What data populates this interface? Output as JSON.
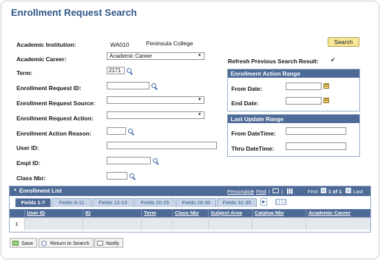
{
  "page": {
    "title": "Enrollment Request Search"
  },
  "search_button": "Search",
  "form": {
    "academic_institution_label": "Academic Institution:",
    "academic_institution_value": "WA010",
    "academic_institution_desc": "Peninsula College",
    "academic_career_label": "Academic Career:",
    "academic_career_value": "Academic Career",
    "term_label": "Term:",
    "term_value": "2171",
    "enrollment_request_id_label": "Enrollment Request ID:",
    "enrollment_request_id_value": "",
    "enrollment_request_source_label": "Enrollment Request Source:",
    "enrollment_request_source_value": "",
    "enrollment_request_action_label": "Enrollment Request Action:",
    "enrollment_request_action_value": "",
    "enrollment_action_reason_label": "Enrollment Action Reason:",
    "enrollment_action_reason_value": "",
    "user_id_label": "User ID:",
    "user_id_value": "",
    "empl_id_label": "Empl ID:",
    "empl_id_value": "",
    "class_nbr_label": "Class Nbr:",
    "class_nbr_value": ""
  },
  "refresh": {
    "label": "Refresh Previous Search Result:",
    "checked": true
  },
  "action_range": {
    "title": "Enrollment Action Range",
    "from_label": "From Date:",
    "end_label": "End Date:"
  },
  "last_update": {
    "title": "Last Update Range",
    "from_label": "From DateTime:",
    "thru_label": "Thru DateTime:"
  },
  "grid": {
    "title": "Enrollment List",
    "personalize": "Personalize",
    "find": "Find",
    "first": "First",
    "count": "1 of 1",
    "last": "Last",
    "tabs": [
      "Fields 1-7",
      "Fields 8-11",
      "Fields 12-19",
      "Fields 20-25",
      "Fields 26-30",
      "Fields 31-35"
    ],
    "columns": [
      "User ID",
      "ID",
      "Term",
      "Class Nbr",
      "Subject Area",
      "Catalog Nbr",
      "Academic Career"
    ],
    "rows": [
      {
        "num": "1"
      }
    ]
  },
  "footer": {
    "save": "Save",
    "return": "Return to Search",
    "notify": "Notify"
  }
}
